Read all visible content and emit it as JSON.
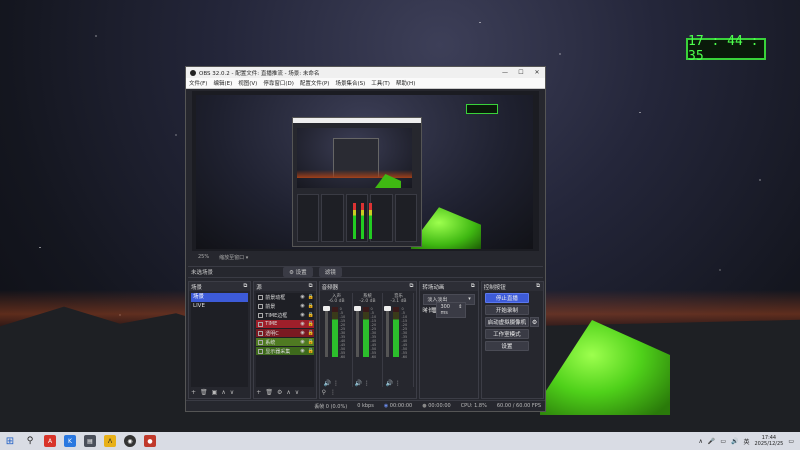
{
  "desktop": {
    "clock": "17 : 44 : 35"
  },
  "window": {
    "title": "OBS 32.0.2 - 配置文件: 直播推流 - 场景: 未命名",
    "controls": [
      "—",
      "☐",
      "✕"
    ],
    "menu": [
      "文件(F)",
      "编辑(E)",
      "视图(V)",
      "停靠窗口(D)",
      "配置文件(P)",
      "场景集合(S)",
      "工具(T)",
      "帮助(H)"
    ]
  },
  "preview_bar": {
    "zoom": "25%",
    "fit": "缩放至窗口 ▾"
  },
  "scene_bar": {
    "no_scene": "未选场景",
    "settings": "⚙ 设置",
    "filters": "滤镜"
  },
  "scenes": {
    "title": "场景",
    "items": [
      {
        "label": "场景",
        "selected": true
      },
      {
        "label": "LIVE",
        "selected": false
      }
    ],
    "footer": [
      "+",
      "🗑",
      "▣",
      "∧",
      "∨"
    ]
  },
  "sources": {
    "title": "源",
    "items": [
      {
        "label": "前景动框",
        "style": ""
      },
      {
        "label": "前景",
        "style": ""
      },
      {
        "label": "TIME边框",
        "style": ""
      },
      {
        "label": "TIME",
        "style": "red"
      },
      {
        "label": "透明C",
        "style": "red2"
      },
      {
        "label": "系统",
        "style": "green"
      },
      {
        "label": "显示器采集",
        "style": "green2"
      }
    ],
    "footer": [
      "+",
      "🗑",
      "⚙",
      "∧",
      "∨"
    ]
  },
  "mixer": {
    "title": "音频器",
    "channels": [
      {
        "name": "入声",
        "db": "-6.0 dB"
      },
      {
        "name": "系统",
        "db": "-2.0 dB"
      },
      {
        "name": "音乐",
        "db": "-3.1 dB"
      }
    ],
    "scale": [
      "0",
      "-5",
      "-10",
      "-15",
      "-20",
      "-25",
      "-30",
      "-35",
      "-40",
      "-45",
      "-50",
      "-55",
      "-60"
    ]
  },
  "transitions": {
    "title": "转场动画",
    "type": "淡入淡出",
    "duration_label": "时长",
    "duration": "300 ms"
  },
  "controls": {
    "title": "控制按钮",
    "buttons": [
      "停止直播",
      "开始录制",
      "启动虚拟摄像机",
      "工作室模式",
      "设置"
    ]
  },
  "status": {
    "dropped": "丢帧 0 (0.0%)",
    "kbps": "0 kbps",
    "live_time": "00:00:00",
    "rec_time": "00:00:00",
    "cpu": "CPU: 1.8%",
    "fps": "60.00 / 60.00 FPS"
  },
  "taskbar": {
    "lang": "英",
    "time": "17:44",
    "date": "2025/12/25"
  }
}
